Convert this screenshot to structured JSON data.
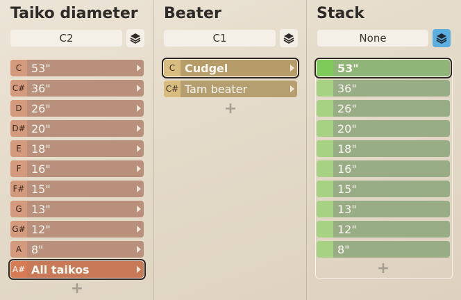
{
  "taiko": {
    "title": "Taiko diameter",
    "selector_value": "C2",
    "rows": [
      {
        "note": "C",
        "label": "53\""
      },
      {
        "note": "C#",
        "label": "36\""
      },
      {
        "note": "D",
        "label": "26\""
      },
      {
        "note": "D#",
        "label": "20\""
      },
      {
        "note": "E",
        "label": "18\""
      },
      {
        "note": "F",
        "label": "16\""
      },
      {
        "note": "F#",
        "label": "15\""
      },
      {
        "note": "G",
        "label": "13\""
      },
      {
        "note": "G#",
        "label": "12\""
      },
      {
        "note": "A",
        "label": "8\""
      },
      {
        "note": "A#",
        "label": "All taikos"
      }
    ],
    "add_label": "+"
  },
  "beater": {
    "title": "Beater",
    "selector_value": "C1",
    "rows": [
      {
        "note": "C",
        "label": "Cudgel"
      },
      {
        "note": "C#",
        "label": "Tam beater"
      }
    ],
    "add_label": "+"
  },
  "stack": {
    "title": "Stack",
    "selector_value": "None",
    "rows": [
      {
        "label": "53\""
      },
      {
        "label": "36\""
      },
      {
        "label": "26\""
      },
      {
        "label": "20\""
      },
      {
        "label": "18\""
      },
      {
        "label": "16\""
      },
      {
        "label": "15\""
      },
      {
        "label": "13\""
      },
      {
        "label": "12\""
      },
      {
        "label": "8\""
      }
    ],
    "add_label": "+"
  }
}
